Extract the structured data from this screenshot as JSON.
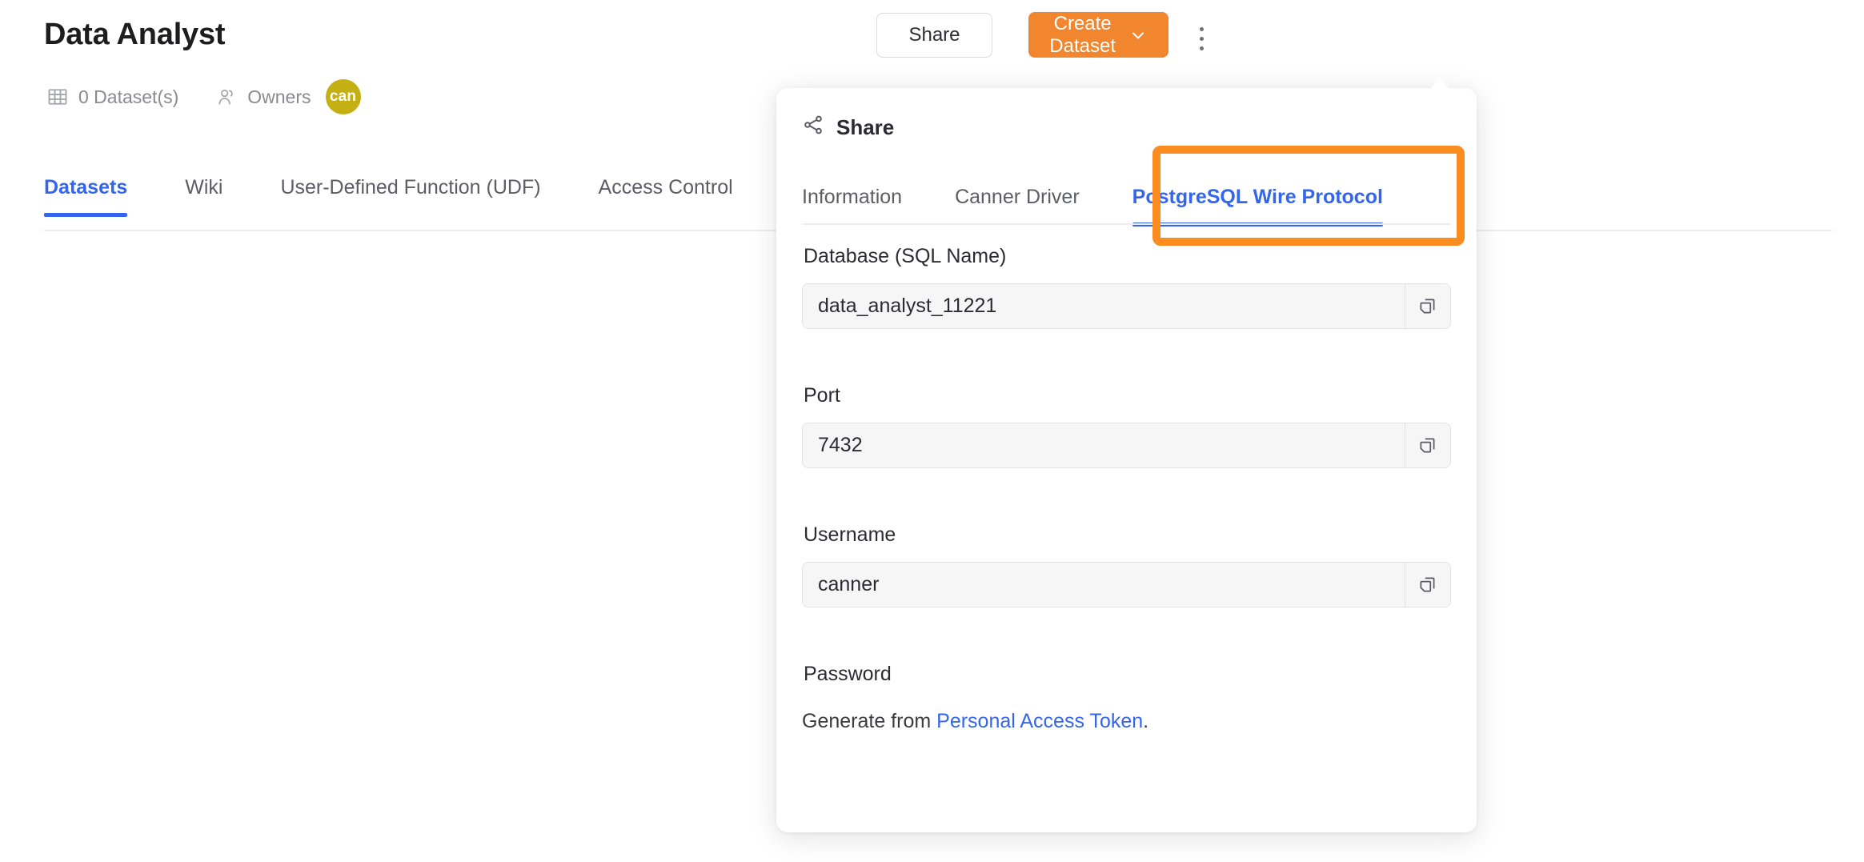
{
  "colors": {
    "accent_blue": "#3366ec",
    "accent_orange": "#f1862f",
    "highlight_orange": "#fb8c20",
    "avatar_yellow": "#c4b013",
    "text_primary": "#2b2b31",
    "text_muted": "#8a8a90"
  },
  "header": {
    "title": "Data Analyst",
    "dataset_count_label": "0 Dataset(s)",
    "dataset_icon": "grid-icon",
    "owners_label": "Owners",
    "owners_icon": "users-icon",
    "avatar_initials": "can",
    "share_button": "Share",
    "create_button": "Create Dataset",
    "create_button_chevron": "chevron-down-icon",
    "more_menu_icon": "kebab-menu-icon"
  },
  "main_tabs": [
    {
      "label": "Datasets",
      "active": true
    },
    {
      "label": "Wiki",
      "active": false
    },
    {
      "label": "User-Defined Function (UDF)",
      "active": false
    },
    {
      "label": "Access Control",
      "active": false
    }
  ],
  "popover": {
    "icon": "share-icon",
    "title": "Share",
    "tabs": [
      {
        "label": "Information",
        "active": false
      },
      {
        "label": "Canner Driver",
        "active": false
      },
      {
        "label": "PostgreSQL Wire Protocol",
        "active": true
      }
    ],
    "highlighted_tab": "PostgreSQL Wire Protocol",
    "fields": [
      {
        "label": "Database (SQL Name)",
        "value": "data_analyst_11221",
        "copy_icon": "copy-icon"
      },
      {
        "label": "Port",
        "value": "7432",
        "copy_icon": "copy-icon"
      },
      {
        "label": "Username",
        "value": "canner",
        "copy_icon": "copy-icon"
      }
    ],
    "password": {
      "label": "Password",
      "note_prefix": "Generate from ",
      "note_link": "Personal Access Token",
      "note_suffix": "."
    }
  }
}
